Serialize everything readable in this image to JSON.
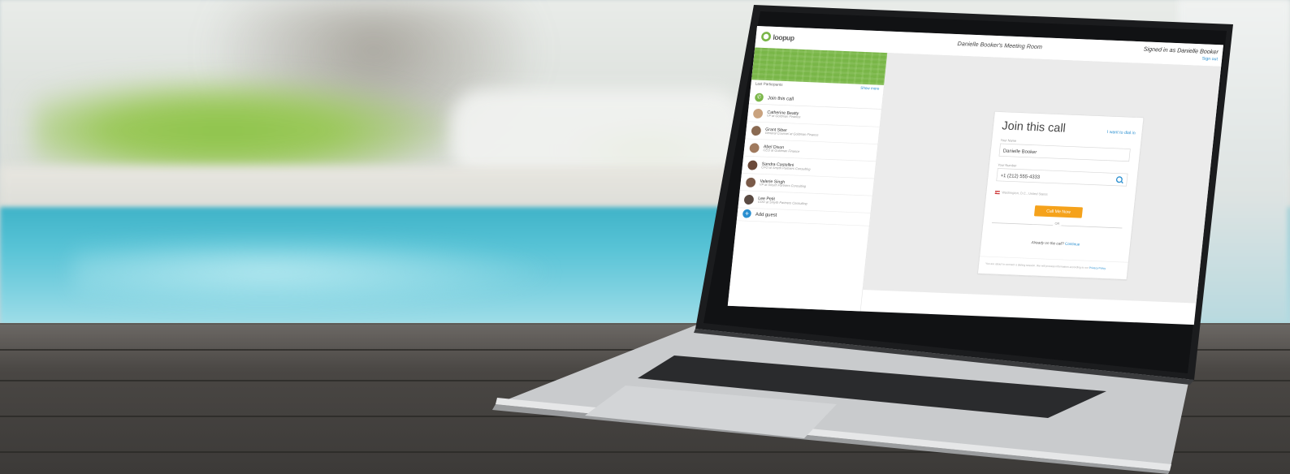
{
  "app": {
    "logo_text": "loopup",
    "room_title": "Danielle Booker's Meeting Room",
    "signed_in": "Signed in as Danielle Booker",
    "sign_out": "Sign out"
  },
  "sidebar": {
    "list_header": "Last Participants",
    "show_more": "Show more",
    "join_label": "Join this call",
    "participants": [
      {
        "name": "Catherine Beatty",
        "role": "VP at Goldman Finance",
        "color": "#c9a27e"
      },
      {
        "name": "Grant Siber",
        "role": "General Counsel at Goldman Finance",
        "color": "#8a6a52"
      },
      {
        "name": "Abel Dixon",
        "role": "CEO at Goldman Finance",
        "color": "#a07a5e"
      },
      {
        "name": "Sandra Castellini",
        "role": "CFO at Smyth Partners Consulting",
        "color": "#6b4a3a"
      },
      {
        "name": "Valerie Singh",
        "role": "VP at Smyth Partners Consulting",
        "color": "#7a5a48"
      },
      {
        "name": "Lee Petit",
        "role": "COO at Smyth Partners Consulting",
        "color": "#5a4a42"
      }
    ],
    "add_guest": "Add guest"
  },
  "join_card": {
    "title": "Join this call",
    "dial_in_link": "I want to dial in",
    "name_label": "Your Name",
    "name_value": "Danielle Booker",
    "number_label": "Your Number",
    "number_value": "+1 (212) 555-4333",
    "location": "Washington, D.C., United States",
    "call_button": "Call Me Now",
    "or_text": "OR",
    "already_text": "Already on the call?",
    "continue_link": "Continue",
    "footer_text": "You are about to connect a dialing session. We will process information according to our",
    "privacy_link": "Privacy Policy"
  },
  "colors": {
    "brand_green": "#7ab648",
    "accent_orange": "#f5a21b",
    "link_blue": "#2a8fd0"
  }
}
